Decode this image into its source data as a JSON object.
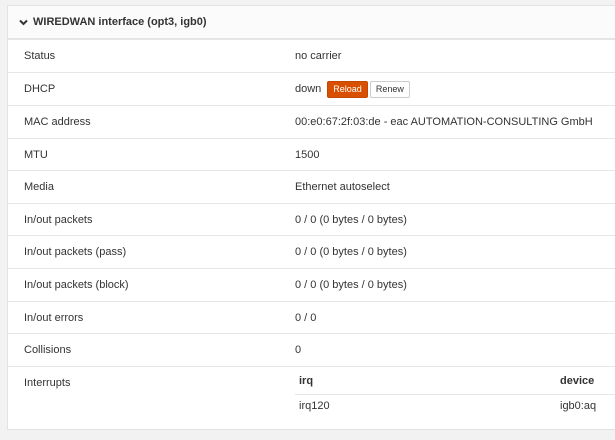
{
  "panel": {
    "title": "WIREDWAN interface (opt3, igb0)",
    "collapse_icon": "chevron-down-icon"
  },
  "rows": {
    "status": {
      "label": "Status",
      "value": "no carrier"
    },
    "dhcp": {
      "label": "DHCP",
      "value": "down",
      "reload_label": "Reload",
      "renew_label": "Renew"
    },
    "mac": {
      "label": "MAC address",
      "value": "00:e0:67:2f:03:de - eac AUTOMATION-CONSULTING GmbH"
    },
    "mtu": {
      "label": "MTU",
      "value": "1500"
    },
    "media": {
      "label": "Media",
      "value": "Ethernet autoselect"
    },
    "inout_packets": {
      "label": "In/out packets",
      "value": "0 / 0 (0 bytes / 0 bytes)"
    },
    "inout_pass": {
      "label": "In/out packets (pass)",
      "value": "0 / 0 (0 bytes / 0 bytes)"
    },
    "inout_block": {
      "label": "In/out packets (block)",
      "value": "0 / 0 (0 bytes / 0 bytes)"
    },
    "inout_errors": {
      "label": "In/out errors",
      "value": "0 / 0"
    },
    "collisions": {
      "label": "Collisions",
      "value": "0"
    },
    "interrupts": {
      "label": "Interrupts",
      "columns": [
        "irq",
        "device"
      ],
      "rows": [
        [
          "irq120",
          "igb0:aq"
        ]
      ]
    }
  },
  "colors": {
    "accent": "#d94f00",
    "background": "#f2f2f2",
    "panel": "#ffffff",
    "border": "#e6e6e6"
  }
}
